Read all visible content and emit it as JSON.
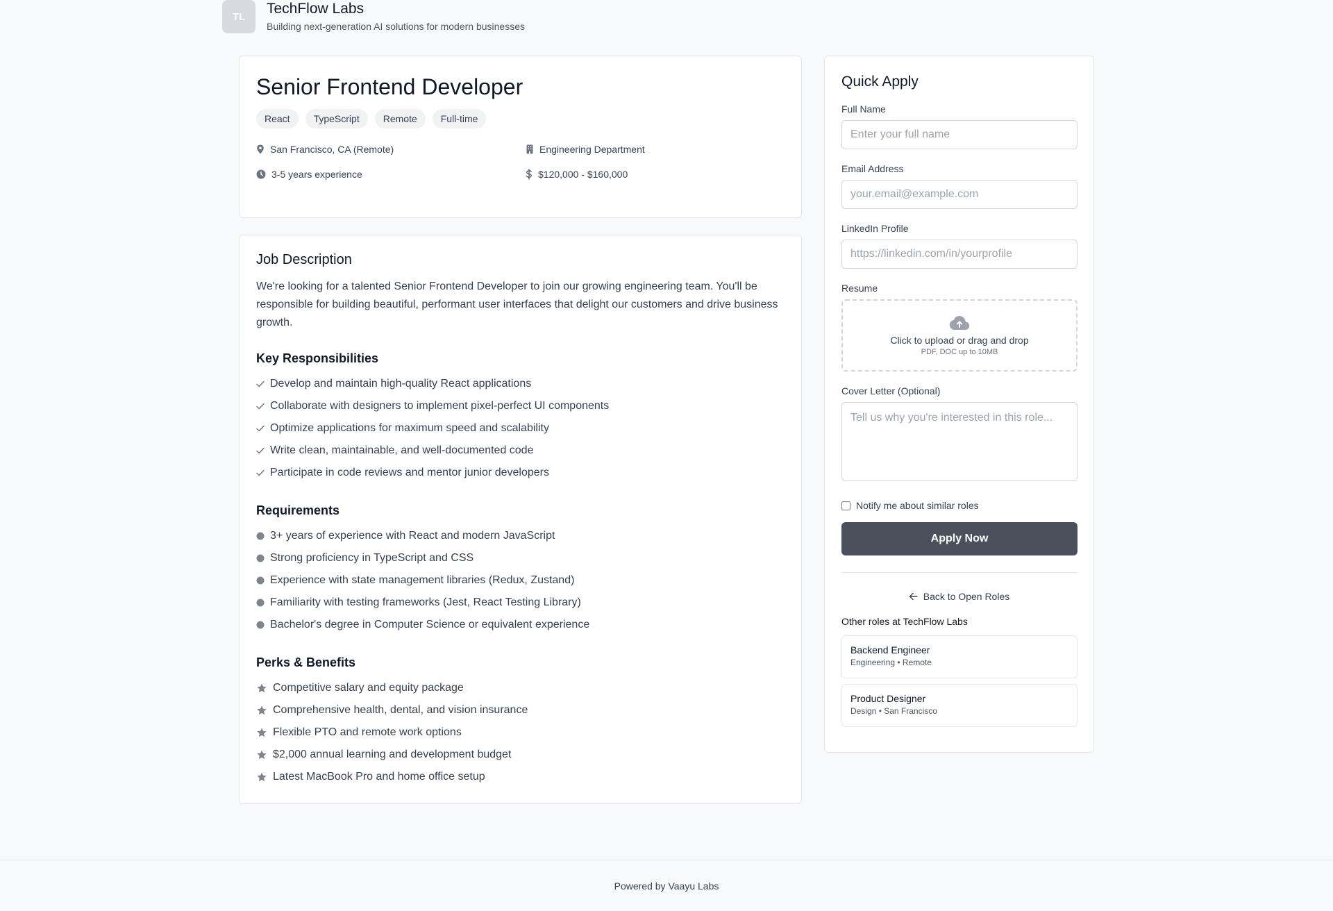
{
  "company": {
    "logo_initials": "TL",
    "name": "TechFlow Labs",
    "tagline": "Building next-generation AI solutions for modern businesses"
  },
  "job": {
    "title": "Senior Frontend Developer",
    "tags": [
      "React",
      "TypeScript",
      "Remote",
      "Full-time"
    ],
    "location": "San Francisco, CA (Remote)",
    "department": "Engineering Department",
    "experience": "3-5 years experience",
    "salary": "$120,000 - $160,000"
  },
  "description": {
    "title": "Job Description",
    "text": "We're looking for a talented Senior Frontend Developer to join our growing engineering team. You'll be responsible for building beautiful, performant user interfaces that delight our customers and drive business growth.",
    "responsibilities_title": "Key Responsibilities",
    "responsibilities": [
      "Develop and maintain high-quality React applications",
      "Collaborate with designers to implement pixel-perfect UI components",
      "Optimize applications for maximum speed and scalability",
      "Write clean, maintainable, and well-documented code",
      "Participate in code reviews and mentor junior developers"
    ],
    "requirements_title": "Requirements",
    "requirements": [
      "3+ years of experience with React and modern JavaScript",
      "Strong proficiency in TypeScript and CSS",
      "Experience with state management libraries (Redux, Zustand)",
      "Familiarity with testing frameworks (Jest, React Testing Library)",
      "Bachelor's degree in Computer Science or equivalent experience"
    ],
    "perks_title": "Perks & Benefits",
    "perks": [
      "Competitive salary and equity package",
      "Comprehensive health, dental, and vision insurance",
      "Flexible PTO and remote work options",
      "$2,000 annual learning and development budget",
      "Latest MacBook Pro and home office setup"
    ]
  },
  "quick_apply": {
    "title": "Quick Apply",
    "full_name_label": "Full Name",
    "full_name_placeholder": "Enter your full name",
    "full_name_value": "",
    "email_label": "Email Address",
    "email_placeholder": "your.email@example.com",
    "email_value": "",
    "linkedin_label": "LinkedIn Profile",
    "linkedin_placeholder": "https://linkedin.com/in/yourprofile",
    "linkedin_value": "",
    "resume_label": "Resume",
    "upload_main": "Click to upload or drag and drop",
    "upload_sub": "PDF, DOC up to 10MB",
    "cover_letter_label": "Cover Letter (Optional)",
    "cover_letter_placeholder": "Tell us why you're interested in this role...",
    "notify_label": "Notify me about similar roles",
    "notify_checked": false,
    "apply_button": "Apply Now",
    "back_link": "Back to Open Roles",
    "other_roles_title": "Other roles at TechFlow Labs",
    "other_roles": [
      {
        "name": "Backend Engineer",
        "meta": "Engineering • Remote"
      },
      {
        "name": "Product Designer",
        "meta": "Design • San Francisco"
      }
    ]
  },
  "footer": {
    "text": "Powered by Vaayu Labs"
  },
  "colors": {
    "primary_button": "#4b515b",
    "page_background": "#f8f9fb",
    "icon_gray": "#6b7280"
  },
  "icons": {
    "location": "map-pin-icon",
    "department": "building-icon",
    "experience": "clock-icon",
    "salary": "dollar-icon",
    "responsibility_bullet": "check-icon",
    "requirement_bullet": "dot-icon",
    "perk_bullet": "star-icon",
    "upload": "cloud-upload-icon",
    "back": "arrow-left-icon"
  }
}
